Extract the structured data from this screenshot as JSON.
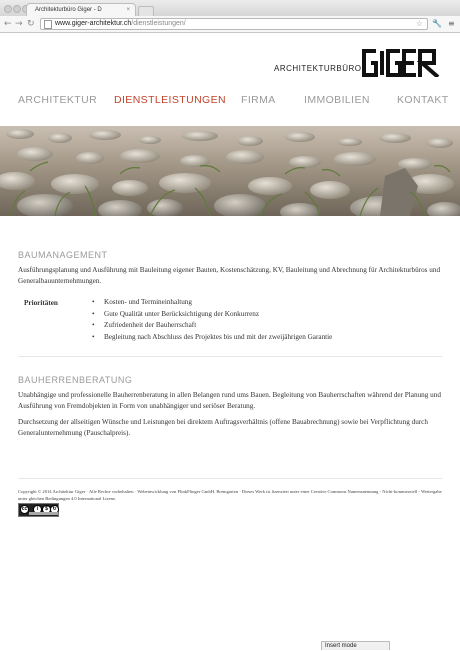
{
  "browser": {
    "tab_title": "Architekturbüro Giger - D",
    "tab_close": "×",
    "url_domain": "www.giger-architektur.ch",
    "url_path": "/dienstleistungen/",
    "status_text": "Insert mode"
  },
  "logo": {
    "text": "ARCHITEKTURBÜRO",
    "brand": "GIGER"
  },
  "nav": [
    "ARCHITEKTUR",
    "DIENSTLEISTUNGEN",
    "FIRMA",
    "IMMOBILIEN",
    "KONTAKT"
  ],
  "colors": {
    "accent": "#c2432c",
    "nav_text": "#9a9a9a"
  },
  "baumanagement": {
    "title": "BAUMANAGEMENT",
    "text": "Ausführungsplanung und Ausführung mit Bauleitung eigener Bauten, Kostenschätzung, KV, Bauleitung und Abrechnung für Architekturbüros und Generalbauunternehmungen.",
    "prio_label": "Prioritäten",
    "bullets": [
      "Kosten- und Termineinhaltung",
      "Gute Qualität unter Berücksichtigung der Konkurrenz",
      "Zufriedenheit der Bauherrschaft",
      "Begleitung nach Abschluss des Projektes bis und mit der zweijährigen Garantie"
    ]
  },
  "bauherrenberatung": {
    "title": "BAUHERRENBERATUNG",
    "p1": "Unabhängige und professionelle Bauherrenberatung in allen Belangen rund ums Bauen. Begleitung von Bauherrschaften während der Planung und Ausführung von Fremdobjekten in Form von unabhängiger und seriöser Beratung.",
    "p2": "Durchsetzung der allseitigen Wünsche und Leistungen bei direktem Auftragsverhältnis (offene Bauabrechnung) sowie bei Verpflichtung durch Generalunternehmung (Pauschalpreis)."
  },
  "footer": {
    "text": "Copyright © 2014 Architektur Giger · Alle Rechte vorbehalten · Webentwicklung von FlinkFlinger GmbH, Bremgarten · Dieses Werk ist lizenziert unter einer Creative Commons Namensnennung - Nicht-kommerziell - Weitergabe unter gleichen Bedingungen 4.0 International Lizenz.",
    "cc_badge": "cc by nc sa"
  }
}
